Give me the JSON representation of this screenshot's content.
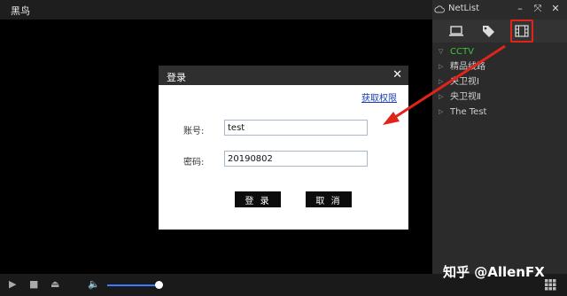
{
  "app": {
    "title": "黑鸟"
  },
  "netlist": {
    "title": "NetList",
    "tabs": [
      {
        "icon": "monitor-icon"
      },
      {
        "icon": "tag-icon"
      },
      {
        "icon": "film-icon"
      }
    ],
    "items": [
      {
        "label": "CCTV",
        "expanded": true
      },
      {
        "label": "精品线路"
      },
      {
        "label": "央卫视Ⅰ"
      },
      {
        "label": "央卫视Ⅱ"
      },
      {
        "label": "The Test"
      }
    ]
  },
  "dialog": {
    "title": "登录",
    "close": "✕",
    "perm_link": "获取权限",
    "account_label": "账号:",
    "account_value": "test",
    "password_label": "密码:",
    "password_value": "20190802",
    "login_button": "登 录",
    "cancel_button": "取 消"
  },
  "watermark": "知乎 @AllenFX",
  "colors": {
    "accent": "#e2231a",
    "expanded": "#3fc43f",
    "volume": "#3b7cff",
    "link": "#1a3cb0"
  }
}
